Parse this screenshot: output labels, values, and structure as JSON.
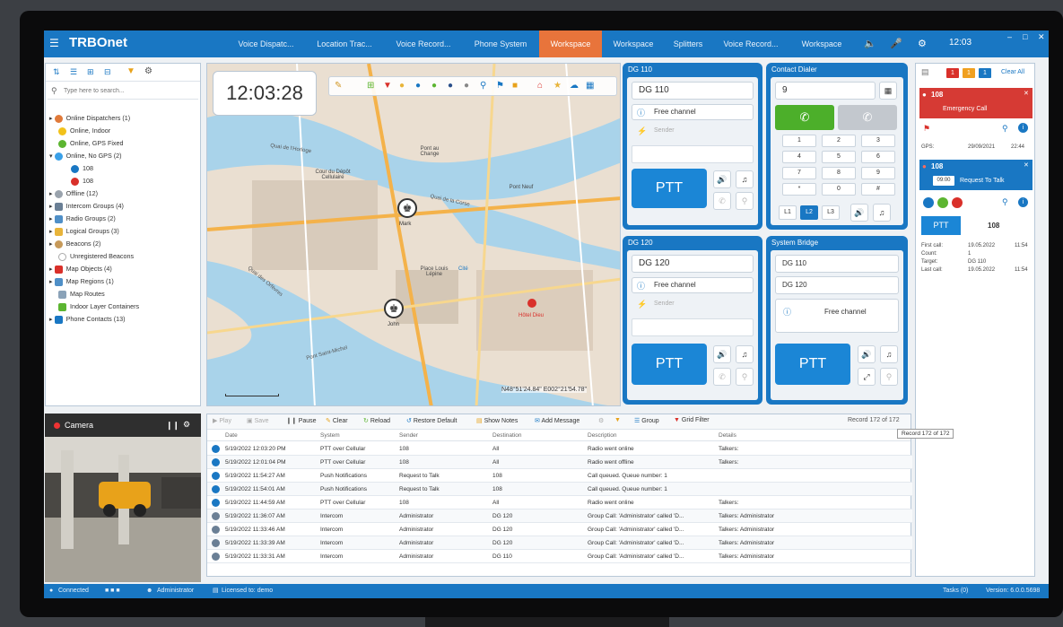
{
  "topbar": {
    "app_name": "TRBOnet",
    "tabs": [
      {
        "label": "Voice Dispatc..."
      },
      {
        "label": "Location Trac..."
      },
      {
        "label": "Voice Record..."
      },
      {
        "label": "Phone System"
      },
      {
        "label": "Workspace"
      },
      {
        "label": "Workspace"
      },
      {
        "label": "Splitters"
      },
      {
        "label": "Voice Record..."
      },
      {
        "label": "Workspace"
      }
    ],
    "clock": "12:03"
  },
  "sidebar": {
    "search_placeholder": "Type here to search...",
    "items": [
      {
        "label": "Online Dispatchers (1)"
      },
      {
        "label": "Online, Indoor"
      },
      {
        "label": "Online, GPS Fixed"
      },
      {
        "label": "Online, No GPS (2)"
      },
      {
        "label": "108"
      },
      {
        "label": "108"
      },
      {
        "label": "Offline (12)"
      },
      {
        "label": "Intercom Groups (4)"
      },
      {
        "label": "Radio Groups (2)"
      },
      {
        "label": "Logical Groups (3)"
      },
      {
        "label": "Beacons (2)"
      },
      {
        "label": "Unregistered Beacons"
      },
      {
        "label": "Map Objects (4)"
      },
      {
        "label": "Map Regions (1)"
      },
      {
        "label": "Map Routes"
      },
      {
        "label": "Indoor Layer Containers"
      },
      {
        "label": "Phone Contacts (13)"
      }
    ]
  },
  "map": {
    "clock": "12:03:28",
    "coords": "N48°51'24.84\" E002°21'54.78\"",
    "labels": {
      "mark": "Mark",
      "john": "John",
      "place_louis": "Place Louis Lépine",
      "cite": "Cité",
      "pont_neuf": "Pont Neuf",
      "pont_change": "Pont au Change",
      "cour_depot": "Cour du Dépôt Cellulaire",
      "quai_corse": "Quai de la Corse",
      "quai_horloge": "Quai de l'Horloge",
      "quai_orfevres": "Quai des Orfèvres",
      "hotel_dieu": "Hôtel Dieu",
      "saint_michel": "Pont Saint-Michel"
    }
  },
  "dg110": {
    "title": "DG 110",
    "name": "DG 110",
    "channel": "Free channel",
    "sender_placeholder": "Sender",
    "ptt": "PTT"
  },
  "dg120": {
    "title": "DG 120",
    "name": "DG 120",
    "channel": "Free channel",
    "sender_placeholder": "Sender",
    "ptt": "PTT"
  },
  "dialer": {
    "title": "Contact Dialer",
    "number": "9",
    "keys": [
      "1",
      "2",
      "3",
      "4",
      "5",
      "6",
      "7",
      "8",
      "9",
      "*",
      "0",
      "#"
    ],
    "lines": [
      "L1",
      "L2",
      "L3"
    ]
  },
  "bridge": {
    "title": "System Bridge",
    "a": "DG 110",
    "b": "DG 120",
    "channel": "Free channel",
    "ptt": "PTT"
  },
  "alerts": {
    "badges": [
      "1",
      "1",
      "1"
    ],
    "clear_all": "Clear All",
    "emergency": {
      "id": "108",
      "type": "Emergency Call",
      "gps_label": "GPS:",
      "date": "29/09/2021",
      "time": "22:44"
    },
    "request": {
      "id": "108",
      "timer": "09:00",
      "type": "Request To Talk"
    },
    "ptt_tab": "PTT",
    "ptt_id": "108",
    "stats": [
      {
        "k": "First call:",
        "v": "19.05.2022",
        "t": "11:54"
      },
      {
        "k": "Count:",
        "v": "1",
        "t": ""
      },
      {
        "k": "Target:",
        "v": "DG 110",
        "t": ""
      },
      {
        "k": "Last call:",
        "v": "19.05.2022",
        "t": "11:54"
      }
    ]
  },
  "camera": {
    "title": "Camera"
  },
  "toolbar": {
    "play": "Play",
    "save": "Save",
    "pause": "Pause",
    "clear": "Clear",
    "reload": "Reload",
    "restore": "Restore Default",
    "show_notes": "Show Notes",
    "add_message": "Add Message",
    "group": "Group",
    "grid_filter": "Grid Filter",
    "record": "Record 172 of 172",
    "tooltip": "Record 172 of 172"
  },
  "events": {
    "headers": [
      "Date",
      "System",
      "Sender",
      "Destination",
      "Description",
      "Details"
    ],
    "rows": [
      {
        "date": "5/19/2022 12:03:20 PM",
        "system": "PTT over Cellular",
        "sender": "108",
        "dest": "All",
        "desc": "Radio went online",
        "details": "Talkers:"
      },
      {
        "date": "5/19/2022 12:01:04 PM",
        "system": "PTT over Cellular",
        "sender": "108",
        "dest": "All",
        "desc": "Radio went offline",
        "details": "Talkers:"
      },
      {
        "date": "5/19/2022 11:54:27 AM",
        "system": "Push Notifications",
        "sender": "Request to Talk",
        "dest": "108",
        "desc": "Call queued. Queue number: 1",
        "details": ""
      },
      {
        "date": "5/19/2022 11:54:01 AM",
        "system": "Push Notifications",
        "sender": "Request to Talk",
        "dest": "108",
        "desc": "Call queued. Queue number: 1",
        "details": ""
      },
      {
        "date": "5/19/2022 11:44:59 AM",
        "system": "PTT over Cellular",
        "sender": "108",
        "dest": "All",
        "desc": "Radio went online",
        "details": "Talkers:"
      },
      {
        "date": "5/19/2022 11:36:07 AM",
        "system": "Intercom",
        "sender": "Administrator",
        "dest": "DG 120",
        "desc": "Group Call: 'Administrator' called 'D...",
        "details": "Talkers: Administrator"
      },
      {
        "date": "5/19/2022 11:33:46 AM",
        "system": "Intercom",
        "sender": "Administrator",
        "dest": "DG 120",
        "desc": "Group Call: 'Administrator' called 'D...",
        "details": "Talkers: Administrator"
      },
      {
        "date": "5/19/2022 11:33:39 AM",
        "system": "Intercom",
        "sender": "Administrator",
        "dest": "DG 120",
        "desc": "Group Call: 'Administrator' called 'D...",
        "details": "Talkers: Administrator"
      },
      {
        "date": "5/19/2022 11:33:31 AM",
        "system": "Intercom",
        "sender": "Administrator",
        "dest": "DG 110",
        "desc": "Group Call: 'Administrator' called 'D...",
        "details": "Talkers: Administrator"
      }
    ]
  },
  "status": {
    "connected": "Connected",
    "user": "Administrator",
    "license": "Licensed to: demo",
    "tasks": "Tasks (0)",
    "version": "Version: 6.0.0.5698"
  }
}
